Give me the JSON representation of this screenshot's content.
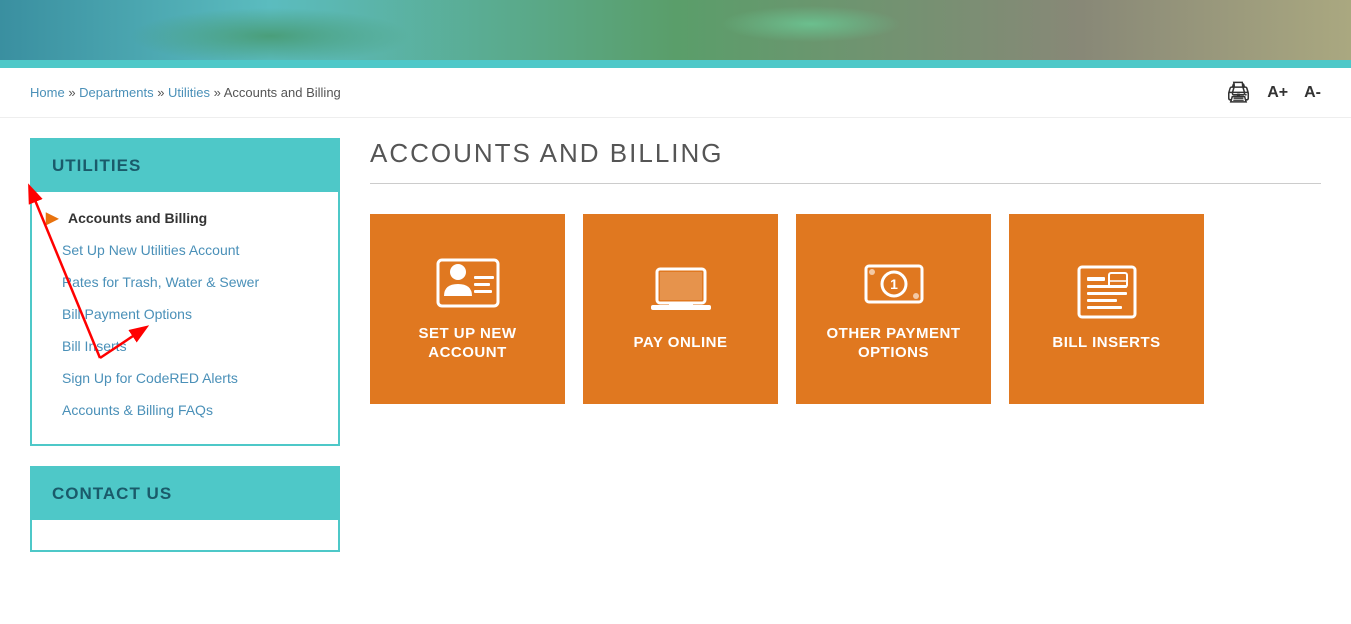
{
  "hero": {
    "alt": "Aerial view of city"
  },
  "breadcrumb": {
    "items": [
      "Home",
      "Departments",
      "Utilities",
      "Accounts and Billing"
    ],
    "separator": "»",
    "current": "Accounts and Billing"
  },
  "toolbar": {
    "print_label": "🖨",
    "increase_font": "A+",
    "decrease_font": "A-"
  },
  "sidebar": {
    "sections": [
      {
        "id": "utilities",
        "title": "UTILITIES",
        "items": [
          {
            "label": "Accounts and Billing",
            "active": true
          },
          {
            "label": "Set Up New Utilities Account",
            "active": false
          },
          {
            "label": "Rates for Trash, Water & Sewer",
            "active": false
          },
          {
            "label": "Bill Payment Options",
            "active": false
          },
          {
            "label": "Bill Inserts",
            "active": false
          },
          {
            "label": "Sign Up for CodeRED Alerts",
            "active": false
          },
          {
            "label": "Accounts & Billing FAQs",
            "active": false
          }
        ]
      },
      {
        "id": "contact-us",
        "title": "CONTACT US",
        "items": []
      }
    ]
  },
  "main": {
    "page_title": "ACCOUNTS AND BILLING",
    "tiles": [
      {
        "id": "set-up-new-account",
        "label": "SET UP NEW\nACCOUNT",
        "label_line1": "SET UP NEW",
        "label_line2": "ACCOUNT",
        "icon": "person-card"
      },
      {
        "id": "pay-online",
        "label": "PAY ONLINE",
        "label_line1": "PAY ONLINE",
        "label_line2": "",
        "icon": "laptop"
      },
      {
        "id": "other-payment-options",
        "label": "OTHER PAYMENT\nOPTIONS",
        "label_line1": "OTHER PAYMENT",
        "label_line2": "OPTIONS",
        "icon": "dollar-coin"
      },
      {
        "id": "bill-inserts",
        "label": "BILL INSERTS",
        "label_line1": "BILL INSERTS",
        "label_line2": "",
        "icon": "bill-document"
      }
    ]
  }
}
